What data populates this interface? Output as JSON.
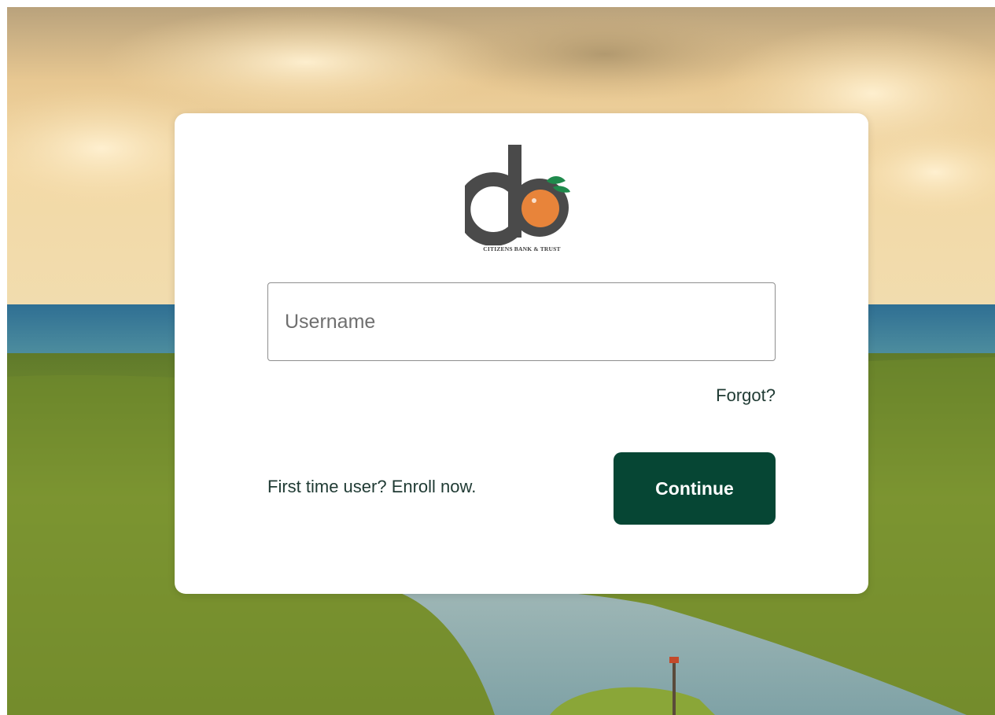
{
  "brand": {
    "logo_text": "CITIZENS BANK & TRUST",
    "colors": {
      "primary": "#064634",
      "orange": "#e8843a",
      "charcoal": "#4a4a4a",
      "leaf": "#1f8a4c"
    }
  },
  "login": {
    "username_placeholder": "Username",
    "username_value": "",
    "forgot_label": "Forgot?",
    "enroll_label": "First time user? Enroll now.",
    "continue_label": "Continue"
  },
  "background": {
    "description_icon": "landscape-photo"
  }
}
